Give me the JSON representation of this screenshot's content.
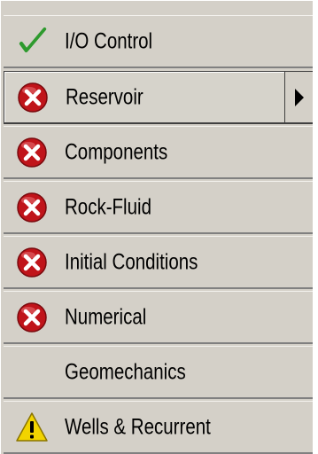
{
  "menu": {
    "items": [
      {
        "label": "I/O Control",
        "status_icon": "check-icon",
        "status": "complete",
        "selected": false,
        "has_submenu": false
      },
      {
        "label": "Reservoir",
        "status_icon": "error-icon",
        "status": "error",
        "selected": true,
        "has_submenu": true
      },
      {
        "label": "Components",
        "status_icon": "error-icon",
        "status": "error",
        "selected": false,
        "has_submenu": false
      },
      {
        "label": "Rock-Fluid",
        "status_icon": "error-icon",
        "status": "error",
        "selected": false,
        "has_submenu": false
      },
      {
        "label": "Initial Conditions",
        "status_icon": "error-icon",
        "status": "error",
        "selected": false,
        "has_submenu": false
      },
      {
        "label": "Numerical",
        "status_icon": "error-icon",
        "status": "error",
        "selected": false,
        "has_submenu": false
      },
      {
        "label": "Geomechanics",
        "status_icon": "none",
        "status": "none",
        "selected": false,
        "has_submenu": false
      },
      {
        "label": "Wells & Recurrent",
        "status_icon": "warning-icon",
        "status": "warning",
        "selected": false,
        "has_submenu": false
      }
    ]
  },
  "colors": {
    "panel_background": "#d4d0c8",
    "check_green": "#2e9a2e",
    "error_red": "#c0141a",
    "warning_yellow": "#f2d400"
  }
}
